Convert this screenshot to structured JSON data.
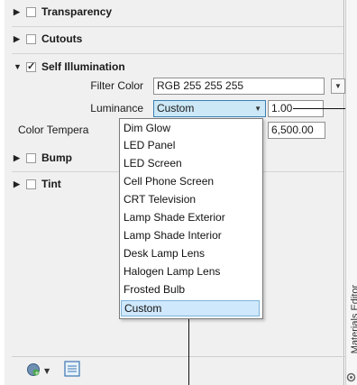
{
  "sections": {
    "transparency": {
      "label": "Transparency",
      "checked": false
    },
    "cutouts": {
      "label": "Cutouts",
      "checked": false
    },
    "self_illumination": {
      "label": "Self Illumination",
      "checked": true
    },
    "bump": {
      "label": "Bump",
      "checked": false
    },
    "tint": {
      "label": "Tint",
      "checked": false
    }
  },
  "fields": {
    "filter_color": {
      "label": "Filter Color",
      "value": "RGB 255 255 255"
    },
    "luminance": {
      "label": "Luminance",
      "selected": "Custom",
      "value": "1.00"
    },
    "color_temperature": {
      "label": "Color Tempera",
      "value": "6,500.00"
    }
  },
  "dropdown": {
    "options": [
      "Dim Glow",
      "LED Panel",
      "LED Screen",
      "Cell Phone Screen",
      "CRT Television",
      "Lamp Shade Exterior",
      "Lamp Shade Interior",
      "Desk Lamp Lens",
      "Halogen Lamp Lens",
      "Frosted Bulb",
      "Custom"
    ],
    "selected_index": 10
  },
  "palette_title": "Materials Editor",
  "icons": {
    "add": "add-material-icon",
    "dropdown": "chevron-down-icon",
    "panel": "panel-icon"
  },
  "colors": {
    "selection_bg": "#cfe8fb",
    "selection_border": "#7db3dc",
    "panel_bg": "#f0f0f0"
  }
}
